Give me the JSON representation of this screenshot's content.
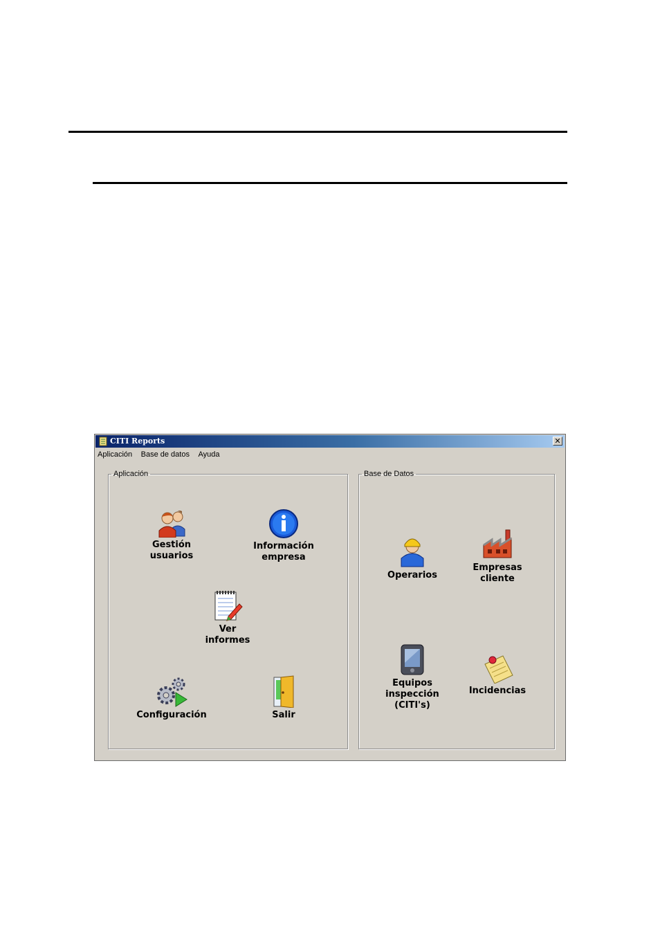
{
  "window": {
    "title": "CITI Reports",
    "close_glyph": "✕"
  },
  "menu": [
    "Aplicación",
    "Base de datos",
    "Ayuda"
  ],
  "groups": {
    "app": {
      "legend": "Aplicación",
      "items": {
        "users": {
          "label": "Gestión\nusuarios",
          "icon": "users-icon"
        },
        "company_info": {
          "label": "Información\nempresa",
          "icon": "info-icon"
        },
        "reports": {
          "label": "Ver\ninformes",
          "icon": "notepad-icon"
        },
        "config": {
          "label": "Configuración",
          "icon": "gears-icon"
        },
        "exit": {
          "label": "Salir",
          "icon": "door-icon"
        }
      }
    },
    "db": {
      "legend": "Base de Datos",
      "items": {
        "operators": {
          "label": "Operarios",
          "icon": "worker-icon"
        },
        "clients": {
          "label": "Empresas\ncliente",
          "icon": "factory-icon"
        },
        "devices": {
          "label": "Equipos\ninspección\n(CITI's)",
          "icon": "pda-icon"
        },
        "incidents": {
          "label": "Incidencias",
          "icon": "note-pin-icon"
        }
      }
    }
  }
}
